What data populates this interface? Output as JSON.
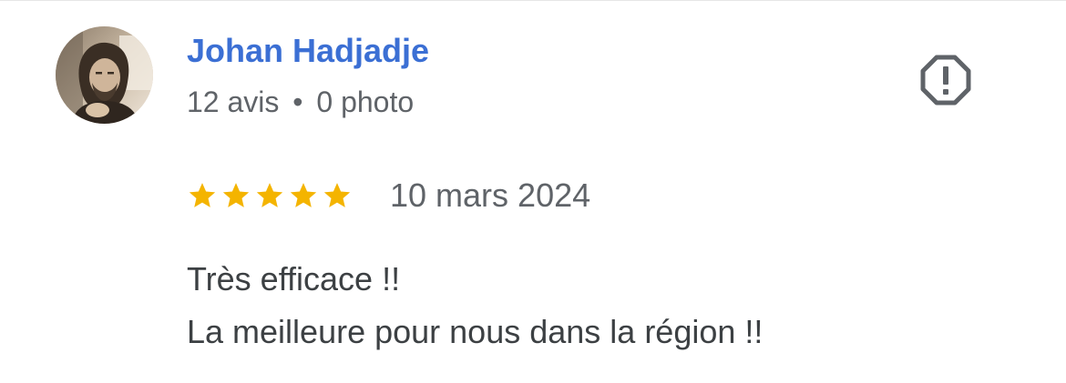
{
  "reviewer": {
    "name": "Johan Hadjadje",
    "reviews_count": "12 avis",
    "separator": "•",
    "photos_count": "0 photo",
    "avatar_icon": "user-avatar-photo"
  },
  "review": {
    "rating": 5,
    "rating_max": 5,
    "date": "10 mars 2024",
    "text_lines": [
      "Très efficace !!",
      "La meilleure pour nous dans la région !!"
    ]
  },
  "actions": {
    "report_icon": "report-icon"
  },
  "colors": {
    "name": "#3b6fd4",
    "meta": "#5f6368",
    "star": "#f4b400",
    "text": "#3c4043",
    "icon": "#5f6368"
  }
}
